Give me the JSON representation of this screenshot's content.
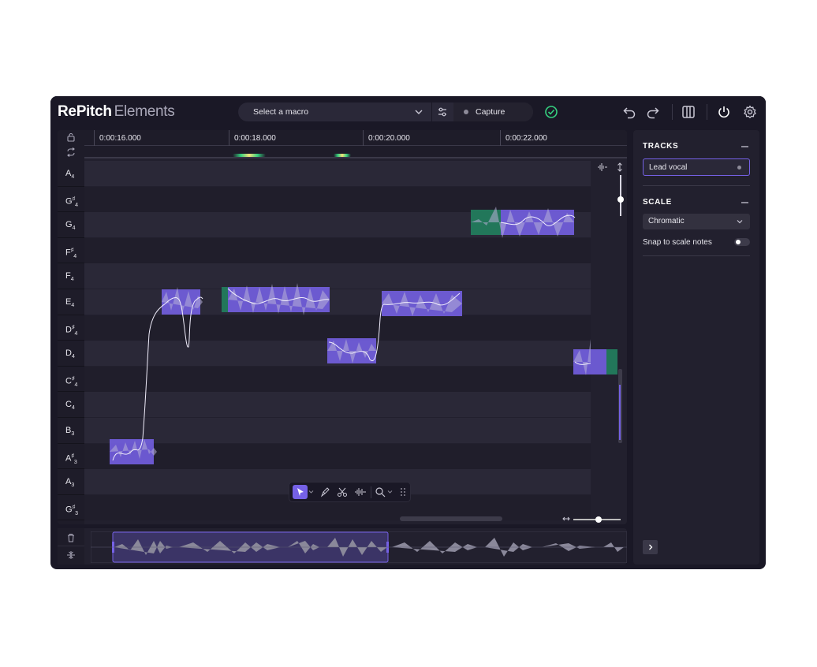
{
  "app": {
    "title_main": "RePitch",
    "title_sub": "Elements"
  },
  "header": {
    "macro_placeholder": "Select a macro",
    "capture_label": "Capture",
    "icons": [
      "chevron-down-icon",
      "adjust-icon",
      "check-circle-icon",
      "undo-icon",
      "redo-icon",
      "columns-icon",
      "power-icon",
      "gear-icon"
    ],
    "accent_green": "#35d07f"
  },
  "ruler": {
    "times": [
      "0:00:16.000",
      "0:00:18.000",
      "0:00:20.000",
      "0:00:22.000"
    ]
  },
  "keys": [
    {
      "note": "A",
      "acc": "",
      "oct": "4"
    },
    {
      "note": "G",
      "acc": "♯",
      "oct": "4"
    },
    {
      "note": "G",
      "acc": "",
      "oct": "4"
    },
    {
      "note": "F",
      "acc": "♯",
      "oct": "4"
    },
    {
      "note": "F",
      "acc": "",
      "oct": "4"
    },
    {
      "note": "E",
      "acc": "",
      "oct": "4"
    },
    {
      "note": "D",
      "acc": "♯",
      "oct": "4"
    },
    {
      "note": "D",
      "acc": "",
      "oct": "4"
    },
    {
      "note": "C",
      "acc": "♯",
      "oct": "4"
    },
    {
      "note": "C",
      "acc": "",
      "oct": "4"
    },
    {
      "note": "B",
      "acc": "",
      "oct": "3"
    },
    {
      "note": "A",
      "acc": "♯",
      "oct": "3"
    },
    {
      "note": "A",
      "acc": "",
      "oct": "3"
    },
    {
      "note": "G",
      "acc": "♯",
      "oct": "3"
    }
  ],
  "colors": {
    "note_purple": "#7561e6",
    "green_segment": "#22775a",
    "background": "#1a1826"
  },
  "panel": {
    "tracks_title": "TRACKS",
    "track_name": "Lead vocal",
    "scale_title": "SCALE",
    "scale_value": "Chromatic",
    "snap_label": "Snap to scale notes",
    "snap_enabled": false
  },
  "toolbar": {
    "tools": [
      "select-arrow-icon",
      "pitch-pen-icon",
      "scissors-icon",
      "waveform-icon",
      "zoom-icon",
      "drag-handle-icon"
    ],
    "active_tool": "select-arrow-icon"
  }
}
